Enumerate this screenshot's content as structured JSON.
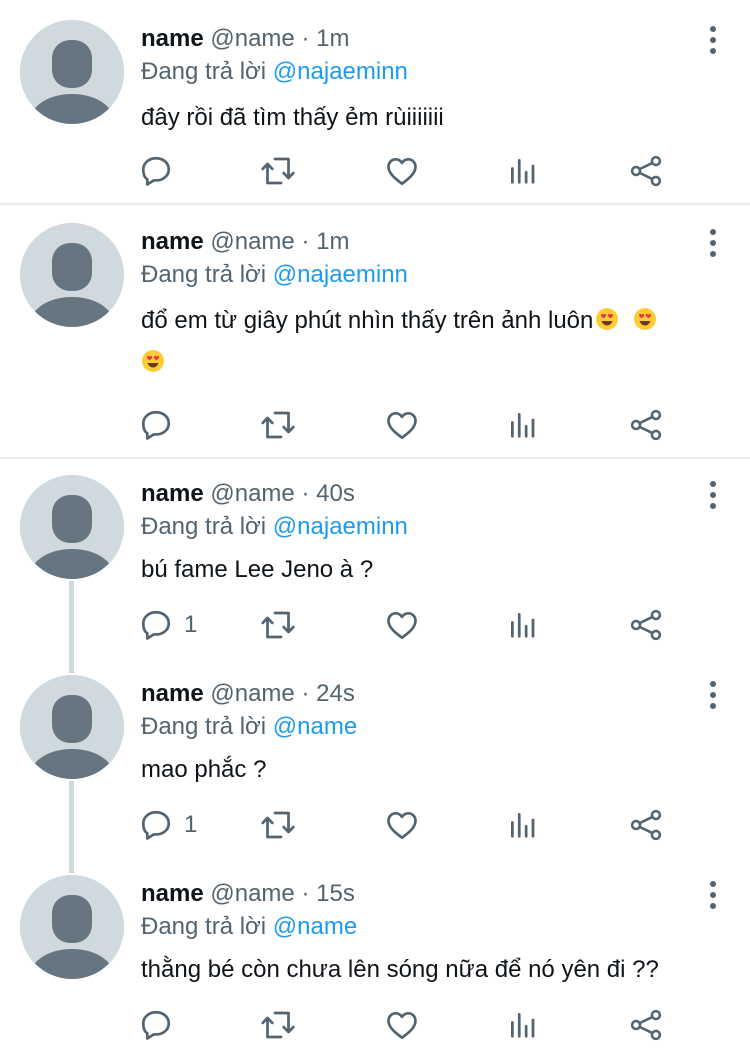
{
  "tweets": [
    {
      "name": "name",
      "handle": "@name",
      "dot": "·",
      "time": "1m",
      "reply_prefix": "Đang trả lời",
      "reply_to": "@najaeminn",
      "text": "đây rồi đã tìm thấy ẻm rùiiiiiii",
      "text_cont": "",
      "reply_count": ""
    },
    {
      "name": "name",
      "handle": "@name",
      "dot": "·",
      "time": "1m",
      "reply_prefix": "Đang trả lời",
      "reply_to": "@najaeminn",
      "text": "đổ em từ giây phút nhìn thấy trên ảnh luôn",
      "emoji": "smiling-face-with-heart-eyes",
      "reply_count": ""
    },
    {
      "name": "name",
      "handle": "@name",
      "dot": "·",
      "time": "40s",
      "reply_prefix": "Đang trả lời",
      "reply_to": "@najaeminn",
      "text": "bú fame Lee Jeno à ?",
      "reply_count": "1"
    },
    {
      "name": "name",
      "handle": "@name",
      "dot": "·",
      "time": "24s",
      "reply_prefix": "Đang trả lời",
      "reply_to": "@name",
      "text": "mao phắc ?",
      "reply_count": "1"
    },
    {
      "name": "name",
      "handle": "@name",
      "dot": "·",
      "time": "15s",
      "reply_prefix": "Đang trả lời",
      "reply_to": "@name",
      "text": "thằng bé còn chưa lên sóng nữa để nó yên đi ??",
      "reply_count": ""
    }
  ],
  "icons": {
    "reply": "reply-icon",
    "retweet": "retweet-icon",
    "like": "heart-icon",
    "views": "analytics-icon",
    "share": "share-icon",
    "more": "more-icon"
  },
  "colors": {
    "text": "#0f1419",
    "secondary": "#536471",
    "link": "#1d9bf0",
    "avatar": "#cfd9de",
    "divider": "#e6ecf0"
  }
}
